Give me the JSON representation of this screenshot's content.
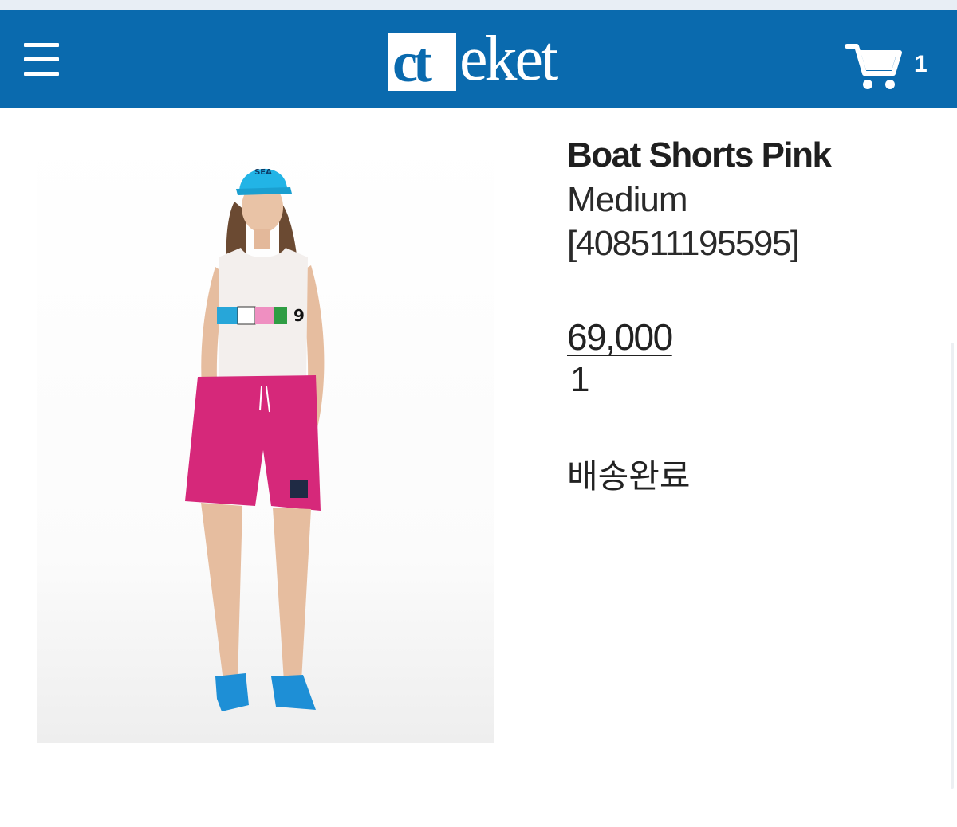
{
  "header": {
    "logo_box_text": "ct",
    "logo_rest_text": "eket",
    "cart_count": "1"
  },
  "product": {
    "name": "Boat Shorts Pink",
    "size": "Medium",
    "sku": "[408511195595]",
    "price": "69,000",
    "quantity": "1",
    "status": "배송완료"
  },
  "colors": {
    "header_bg": "#0a6aae",
    "shorts": "#d6287a",
    "cap": "#22b4e6"
  }
}
